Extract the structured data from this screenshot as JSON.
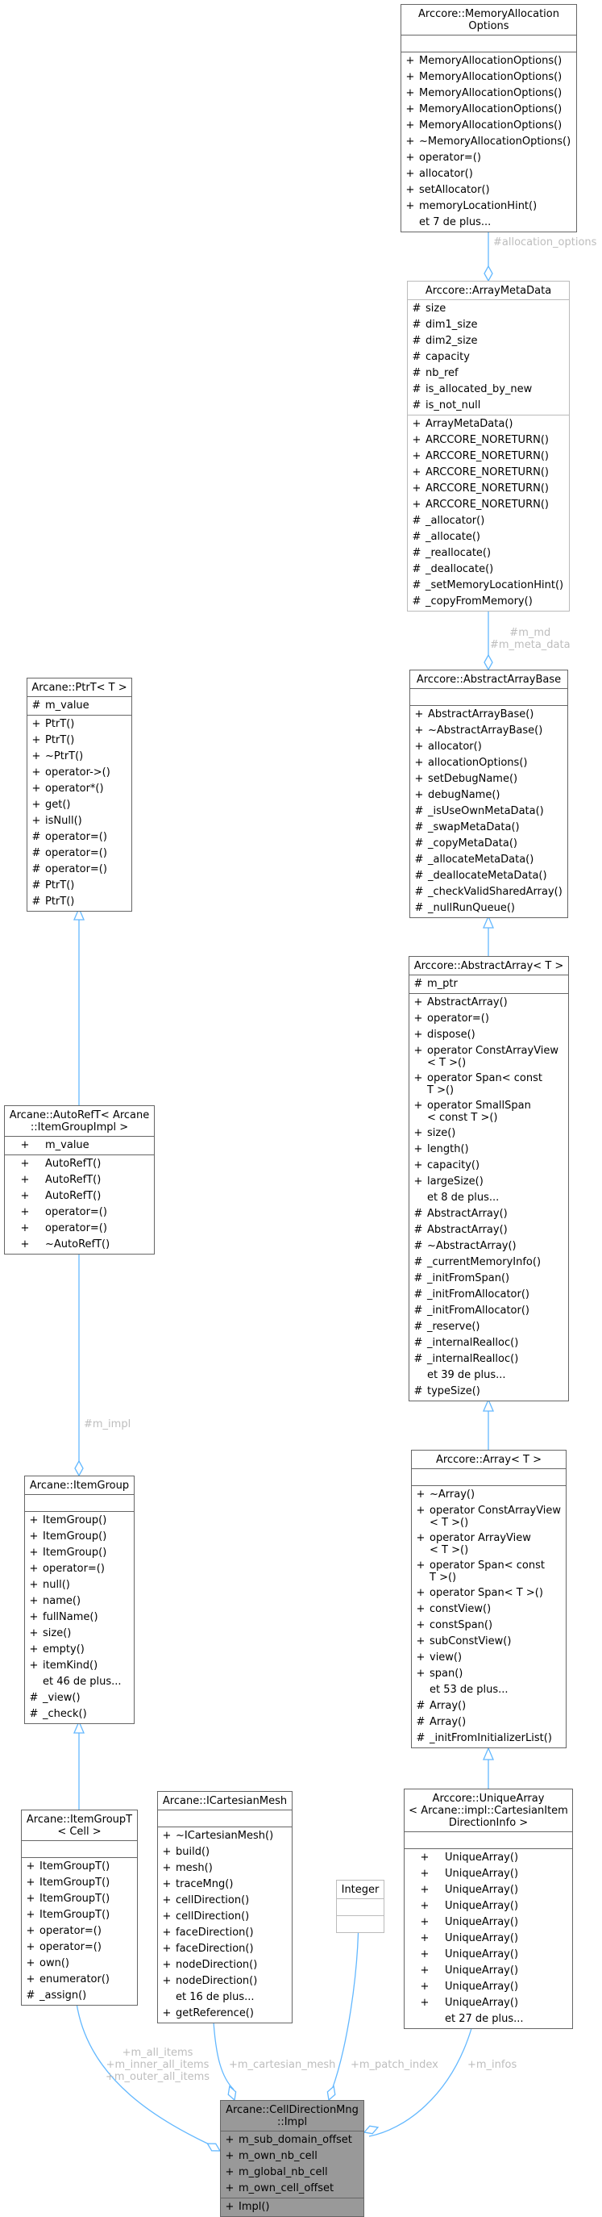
{
  "colors": {
    "edge": "#63b8ff",
    "label": "#bdbdbd",
    "box_border": "#666666",
    "main_fill": "#999999"
  },
  "classes": {
    "memalloc": {
      "title": "Arccore::MemoryAllocation\nOptions",
      "attrs": [],
      "methods": [
        {
          "v": "+",
          "n": "MemoryAllocationOptions()"
        },
        {
          "v": "+",
          "n": "MemoryAllocationOptions()"
        },
        {
          "v": "+",
          "n": "MemoryAllocationOptions()"
        },
        {
          "v": "+",
          "n": "MemoryAllocationOptions()"
        },
        {
          "v": "+",
          "n": "MemoryAllocationOptions()"
        },
        {
          "v": "+",
          "n": "~MemoryAllocationOptions()"
        },
        {
          "v": "+",
          "n": "operator=()"
        },
        {
          "v": "+",
          "n": "allocator()"
        },
        {
          "v": "+",
          "n": "setAllocator()"
        },
        {
          "v": "+",
          "n": "memoryLocationHint()"
        },
        {
          "v": "",
          "n": "et 7 de plus..."
        }
      ]
    },
    "arraymeta": {
      "title": "Arccore::ArrayMetaData",
      "attrs": [
        {
          "v": "#",
          "n": "size"
        },
        {
          "v": "#",
          "n": "dim1_size"
        },
        {
          "v": "#",
          "n": "dim2_size"
        },
        {
          "v": "#",
          "n": "capacity"
        },
        {
          "v": "#",
          "n": "nb_ref"
        },
        {
          "v": "#",
          "n": "is_allocated_by_new"
        },
        {
          "v": "#",
          "n": "is_not_null"
        }
      ],
      "methods": [
        {
          "v": "+",
          "n": "ArrayMetaData()"
        },
        {
          "v": "+",
          "n": "ARCCORE_NORETURN()"
        },
        {
          "v": "+",
          "n": "ARCCORE_NORETURN()"
        },
        {
          "v": "+",
          "n": "ARCCORE_NORETURN()"
        },
        {
          "v": "+",
          "n": "ARCCORE_NORETURN()"
        },
        {
          "v": "+",
          "n": "ARCCORE_NORETURN()"
        },
        {
          "v": "#",
          "n": "_allocator()"
        },
        {
          "v": "#",
          "n": "_allocate()"
        },
        {
          "v": "#",
          "n": "_reallocate()"
        },
        {
          "v": "#",
          "n": "_deallocate()"
        },
        {
          "v": "#",
          "n": "_setMemoryLocationHint()"
        },
        {
          "v": "#",
          "n": "_copyFromMemory()"
        }
      ]
    },
    "abstractbase": {
      "title": "Arccore::AbstractArrayBase",
      "attrs": [],
      "methods": [
        {
          "v": "+",
          "n": "AbstractArrayBase()"
        },
        {
          "v": "+",
          "n": "~AbstractArrayBase()"
        },
        {
          "v": "+",
          "n": "allocator()"
        },
        {
          "v": "+",
          "n": "allocationOptions()"
        },
        {
          "v": "+",
          "n": "setDebugName()"
        },
        {
          "v": "+",
          "n": "debugName()"
        },
        {
          "v": "#",
          "n": "_isUseOwnMetaData()"
        },
        {
          "v": "#",
          "n": "_swapMetaData()"
        },
        {
          "v": "#",
          "n": "_copyMetaData()"
        },
        {
          "v": "#",
          "n": "_allocateMetaData()"
        },
        {
          "v": "#",
          "n": "_deallocateMetaData()"
        },
        {
          "v": "#",
          "n": "_checkValidSharedArray()"
        },
        {
          "v": "#",
          "n": "_nullRunQueue()"
        }
      ]
    },
    "abstractarray": {
      "title": "Arccore::AbstractArray< T >",
      "attrs": [
        {
          "v": "#",
          "n": "m_ptr"
        }
      ],
      "methods": [
        {
          "v": "+",
          "n": "AbstractArray()"
        },
        {
          "v": "+",
          "n": "operator=()"
        },
        {
          "v": "+",
          "n": "dispose()"
        },
        {
          "v": "+",
          "n": "operator ConstArrayView\n< T >()"
        },
        {
          "v": "+",
          "n": "operator Span< const\n T >()"
        },
        {
          "v": "+",
          "n": "operator SmallSpan\n< const T >()"
        },
        {
          "v": "+",
          "n": "size()"
        },
        {
          "v": "+",
          "n": "length()"
        },
        {
          "v": "+",
          "n": "capacity()"
        },
        {
          "v": "+",
          "n": "largeSize()"
        },
        {
          "v": "",
          "n": "et 8 de plus..."
        },
        {
          "v": "#",
          "n": "AbstractArray()"
        },
        {
          "v": "#",
          "n": "AbstractArray()"
        },
        {
          "v": "#",
          "n": "~AbstractArray()"
        },
        {
          "v": "#",
          "n": "_currentMemoryInfo()"
        },
        {
          "v": "#",
          "n": "_initFromSpan()"
        },
        {
          "v": "#",
          "n": "_initFromAllocator()"
        },
        {
          "v": "#",
          "n": "_initFromAllocator()"
        },
        {
          "v": "#",
          "n": "_reserve()"
        },
        {
          "v": "#",
          "n": "_internalRealloc()"
        },
        {
          "v": "#",
          "n": "_internalRealloc()"
        },
        {
          "v": "",
          "n": "et 39 de plus..."
        },
        {
          "v": "#",
          "n": "typeSize()"
        }
      ]
    },
    "array": {
      "title": "Arccore::Array< T >",
      "attrs": [],
      "methods": [
        {
          "v": "+",
          "n": "~Array()"
        },
        {
          "v": "+",
          "n": "operator ConstArrayView\n< T >()"
        },
        {
          "v": "+",
          "n": "operator ArrayView\n< T >()"
        },
        {
          "v": "+",
          "n": "operator Span< const\n T >()"
        },
        {
          "v": "+",
          "n": "operator Span< T >()"
        },
        {
          "v": "+",
          "n": "constView()"
        },
        {
          "v": "+",
          "n": "constSpan()"
        },
        {
          "v": "+",
          "n": "subConstView()"
        },
        {
          "v": "+",
          "n": "view()"
        },
        {
          "v": "+",
          "n": "span()"
        },
        {
          "v": "",
          "n": "et 53 de plus..."
        },
        {
          "v": "#",
          "n": "Array()"
        },
        {
          "v": "#",
          "n": "Array()"
        },
        {
          "v": "#",
          "n": "_initFromInitializerList()"
        }
      ]
    },
    "uniquearray": {
      "title": "Arccore::UniqueArray\n< Arcane::impl::CartesianItem\nDirectionInfo >",
      "attrs": [],
      "methods": [
        {
          "v": "+",
          "n": "UniqueArray()"
        },
        {
          "v": "+",
          "n": "UniqueArray()"
        },
        {
          "v": "+",
          "n": "UniqueArray()"
        },
        {
          "v": "+",
          "n": "UniqueArray()"
        },
        {
          "v": "+",
          "n": "UniqueArray()"
        },
        {
          "v": "+",
          "n": "UniqueArray()"
        },
        {
          "v": "+",
          "n": "UniqueArray()"
        },
        {
          "v": "+",
          "n": "UniqueArray()"
        },
        {
          "v": "+",
          "n": "UniqueArray()"
        },
        {
          "v": "+",
          "n": "UniqueArray()"
        },
        {
          "v": "",
          "n": "et 27 de plus..."
        }
      ]
    },
    "ptrt": {
      "title": "Arcane::PtrT< T >",
      "attrs": [
        {
          "v": "#",
          "n": "m_value"
        }
      ],
      "methods": [
        {
          "v": "+",
          "n": "PtrT()"
        },
        {
          "v": "+",
          "n": "PtrT()"
        },
        {
          "v": "+",
          "n": "~PtrT()"
        },
        {
          "v": "+",
          "n": "operator->()"
        },
        {
          "v": "+",
          "n": "operator*()"
        },
        {
          "v": "+",
          "n": "get()"
        },
        {
          "v": "+",
          "n": "isNull()"
        },
        {
          "v": "#",
          "n": "operator=()"
        },
        {
          "v": "#",
          "n": "operator=()"
        },
        {
          "v": "#",
          "n": "operator=()"
        },
        {
          "v": "#",
          "n": "PtrT()"
        },
        {
          "v": "#",
          "n": "PtrT()"
        }
      ]
    },
    "autoreft": {
      "title": "Arcane::AutoRefT< Arcane\n::ItemGroupImpl >",
      "attrs": [
        {
          "v": "+",
          "n": "m_value"
        }
      ],
      "methods": [
        {
          "v": "+",
          "n": "AutoRefT()"
        },
        {
          "v": "+",
          "n": "AutoRefT()"
        },
        {
          "v": "+",
          "n": "AutoRefT()"
        },
        {
          "v": "+",
          "n": "operator=()"
        },
        {
          "v": "+",
          "n": "operator=()"
        },
        {
          "v": "+",
          "n": "~AutoRefT()"
        }
      ]
    },
    "itemgroup": {
      "title": "Arcane::ItemGroup",
      "attrs": [],
      "methods": [
        {
          "v": "+",
          "n": "ItemGroup()"
        },
        {
          "v": "+",
          "n": "ItemGroup()"
        },
        {
          "v": "+",
          "n": "ItemGroup()"
        },
        {
          "v": "+",
          "n": "operator=()"
        },
        {
          "v": "+",
          "n": "null()"
        },
        {
          "v": "+",
          "n": "name()"
        },
        {
          "v": "+",
          "n": "fullName()"
        },
        {
          "v": "+",
          "n": "size()"
        },
        {
          "v": "+",
          "n": "empty()"
        },
        {
          "v": "+",
          "n": "itemKind()"
        },
        {
          "v": "",
          "n": "et 46 de plus..."
        },
        {
          "v": "#",
          "n": "_view()"
        },
        {
          "v": "#",
          "n": "_check()"
        }
      ]
    },
    "itemgroupt": {
      "title": "Arcane::ItemGroupT\n< Cell >",
      "attrs": [],
      "methods": [
        {
          "v": "+",
          "n": "ItemGroupT()"
        },
        {
          "v": "+",
          "n": "ItemGroupT()"
        },
        {
          "v": "+",
          "n": "ItemGroupT()"
        },
        {
          "v": "+",
          "n": "ItemGroupT()"
        },
        {
          "v": "+",
          "n": "operator=()"
        },
        {
          "v": "+",
          "n": "operator=()"
        },
        {
          "v": "+",
          "n": "own()"
        },
        {
          "v": "+",
          "n": "enumerator()"
        },
        {
          "v": "#",
          "n": "_assign()"
        }
      ]
    },
    "icartesian": {
      "title": "Arcane::ICartesianMesh",
      "attrs": [],
      "methods": [
        {
          "v": "+",
          "n": "~ICartesianMesh()"
        },
        {
          "v": "+",
          "n": "build()"
        },
        {
          "v": "+",
          "n": "mesh()"
        },
        {
          "v": "+",
          "n": "traceMng()"
        },
        {
          "v": "+",
          "n": "cellDirection()"
        },
        {
          "v": "+",
          "n": "cellDirection()"
        },
        {
          "v": "+",
          "n": "faceDirection()"
        },
        {
          "v": "+",
          "n": "faceDirection()"
        },
        {
          "v": "+",
          "n": "nodeDirection()"
        },
        {
          "v": "+",
          "n": "nodeDirection()"
        },
        {
          "v": "",
          "n": "et 16 de plus..."
        },
        {
          "v": "+",
          "n": "getReference()"
        }
      ]
    },
    "integer": {
      "title": "Integer",
      "attrs": [],
      "methods": []
    },
    "impl": {
      "title": "Arcane::CellDirectionMng\n::Impl",
      "attrs": [
        {
          "v": "+",
          "n": "m_sub_domain_offset"
        },
        {
          "v": "+",
          "n": "m_own_nb_cell"
        },
        {
          "v": "+",
          "n": "m_global_nb_cell"
        },
        {
          "v": "+",
          "n": "m_own_cell_offset"
        }
      ],
      "methods": [
        {
          "v": "+",
          "n": "Impl()"
        }
      ]
    }
  },
  "edge_labels": {
    "allocation_options": "#allocation_options",
    "meta_data": "#m_md\n#m_meta_data",
    "m_impl": "#m_impl",
    "all_items": "+m_all_items\n+m_inner_all_items\n+m_outer_all_items",
    "cartesian_mesh": "+m_cartesian_mesh",
    "patch_index": "+m_patch_index",
    "infos": "+m_infos"
  }
}
